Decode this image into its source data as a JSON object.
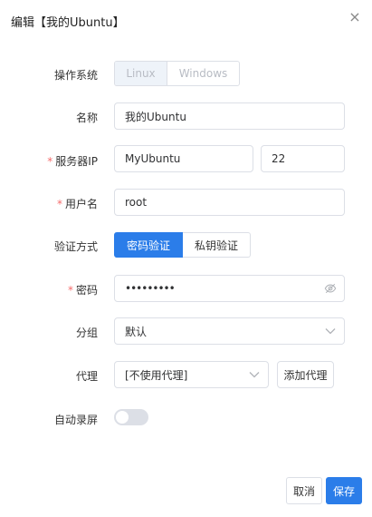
{
  "dialog": {
    "title": "编辑【我的Ubuntu】",
    "close_glyph": "×"
  },
  "form": {
    "os": {
      "label": "操作系统",
      "options": [
        "Linux",
        "Windows"
      ],
      "selected": "Linux"
    },
    "name": {
      "label": "名称",
      "value": "我的Ubuntu"
    },
    "server": {
      "label": "服务器IP",
      "required_mark": "*",
      "host": "MyUbuntu",
      "port": "22"
    },
    "username": {
      "label": "用户名",
      "required_mark": "*",
      "value": "root"
    },
    "auth": {
      "label": "验证方式",
      "options": [
        "密码验证",
        "私钥验证"
      ],
      "selected": "密码验证"
    },
    "password": {
      "label": "密码",
      "required_mark": "*",
      "value": "•••••••••",
      "reveal_icon": "eye-off-icon"
    },
    "group": {
      "label": "分组",
      "value": "默认",
      "dropdown_icon": "chevron-down-icon"
    },
    "proxy": {
      "label": "代理",
      "value": "[不使用代理]",
      "dropdown_icon": "chevron-down-icon",
      "add_label": "添加代理"
    },
    "auto_record": {
      "label": "自动录屏",
      "enabled": false
    }
  },
  "footer": {
    "cancel_label": "取消",
    "save_label": "保存"
  },
  "colors": {
    "primary": "#2b7de9",
    "required": "#f56c6c",
    "border": "#dcdfe6"
  }
}
